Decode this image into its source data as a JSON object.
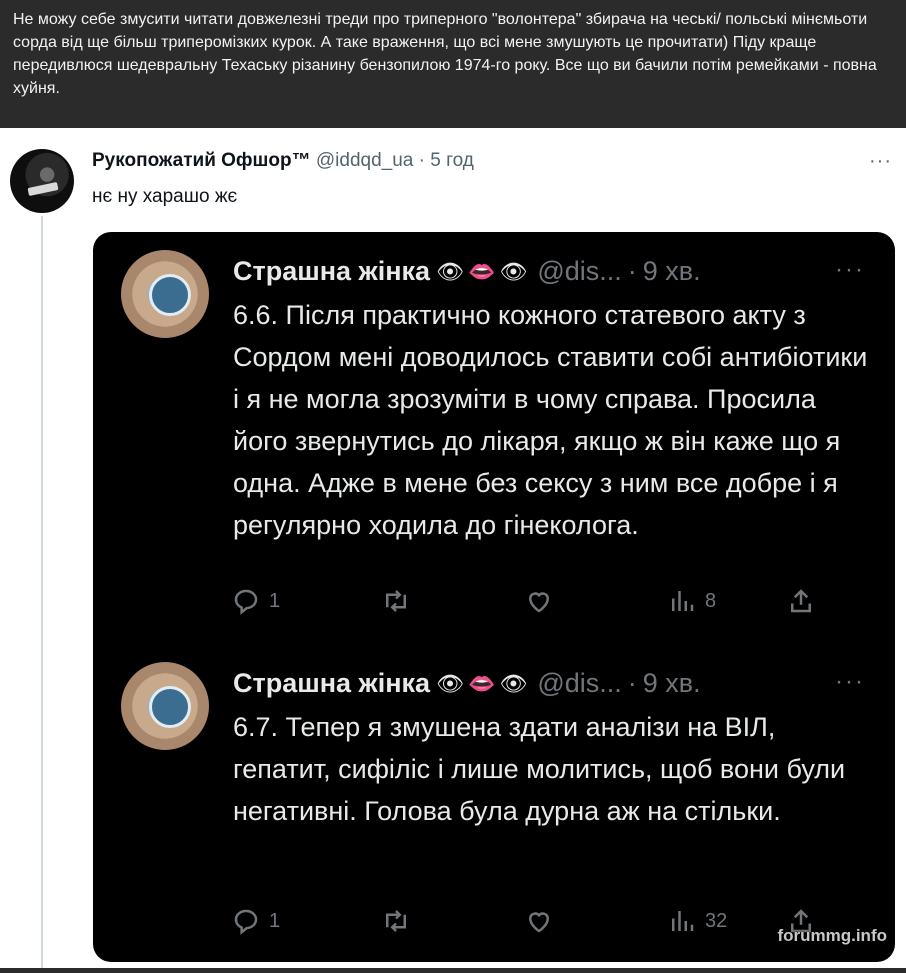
{
  "caption": {
    "text": "Не можу себе змусити читати довжелезні треди про триперного \"волонтера\" збирача на чеські/ польські мінємьоти сорда від ще більш триперомізких курок. А таке враження, що всі мене змушують це прочитати) Піду краще передивлюся шедевральну Техаську різанину бензопилою 1974-го року. Все що ви бачили потім ремейками - повна хуйня."
  },
  "outer_tweet": {
    "name": "Рукопожатий Офшор™",
    "handle": "@iddqd_ua",
    "separator": "·",
    "time": "5 год",
    "text": "нє ну харашо жє",
    "more": "···"
  },
  "quoted_tweets": [
    {
      "name": "Страшна жінка",
      "emoji": "👁👄👁",
      "handle": "@dis...",
      "separator": "·",
      "time": "9 хв.",
      "more": "···",
      "text": "6.6. Після практично кожного статевого акту з Сордом мені доводилось ставити собі антибіотики і я не могла зрозуміти в чому справа. Просила його звернутись до лікаря, якщо ж він каже що я одна. Адже в мене без сексу з ним все добре і я регулярно ходила до гінеколога.",
      "reply_count": "1",
      "views_count": "8"
    },
    {
      "name": "Страшна жінка",
      "emoji": "👁👄👁",
      "handle": "@dis...",
      "separator": "·",
      "time": "9 хв.",
      "more": "···",
      "text": "6.7. Тепер я змушена здати аналізи на ВІЛ, гепатит, сифіліс і лише молитись, щоб вони були негативні. Голова була дурна аж на стільки.",
      "reply_count": "1",
      "views_count": "32"
    }
  ],
  "watermark": "forummg.info",
  "icons": [
    "reply-icon",
    "retweet-icon",
    "like-icon",
    "views-icon",
    "share-icon",
    "more-icon"
  ],
  "colors": {
    "card_bg": "#000000",
    "caption_bg": "#2b2b2b",
    "text_dark": "#e7e9ea",
    "muted": "#71767b"
  }
}
